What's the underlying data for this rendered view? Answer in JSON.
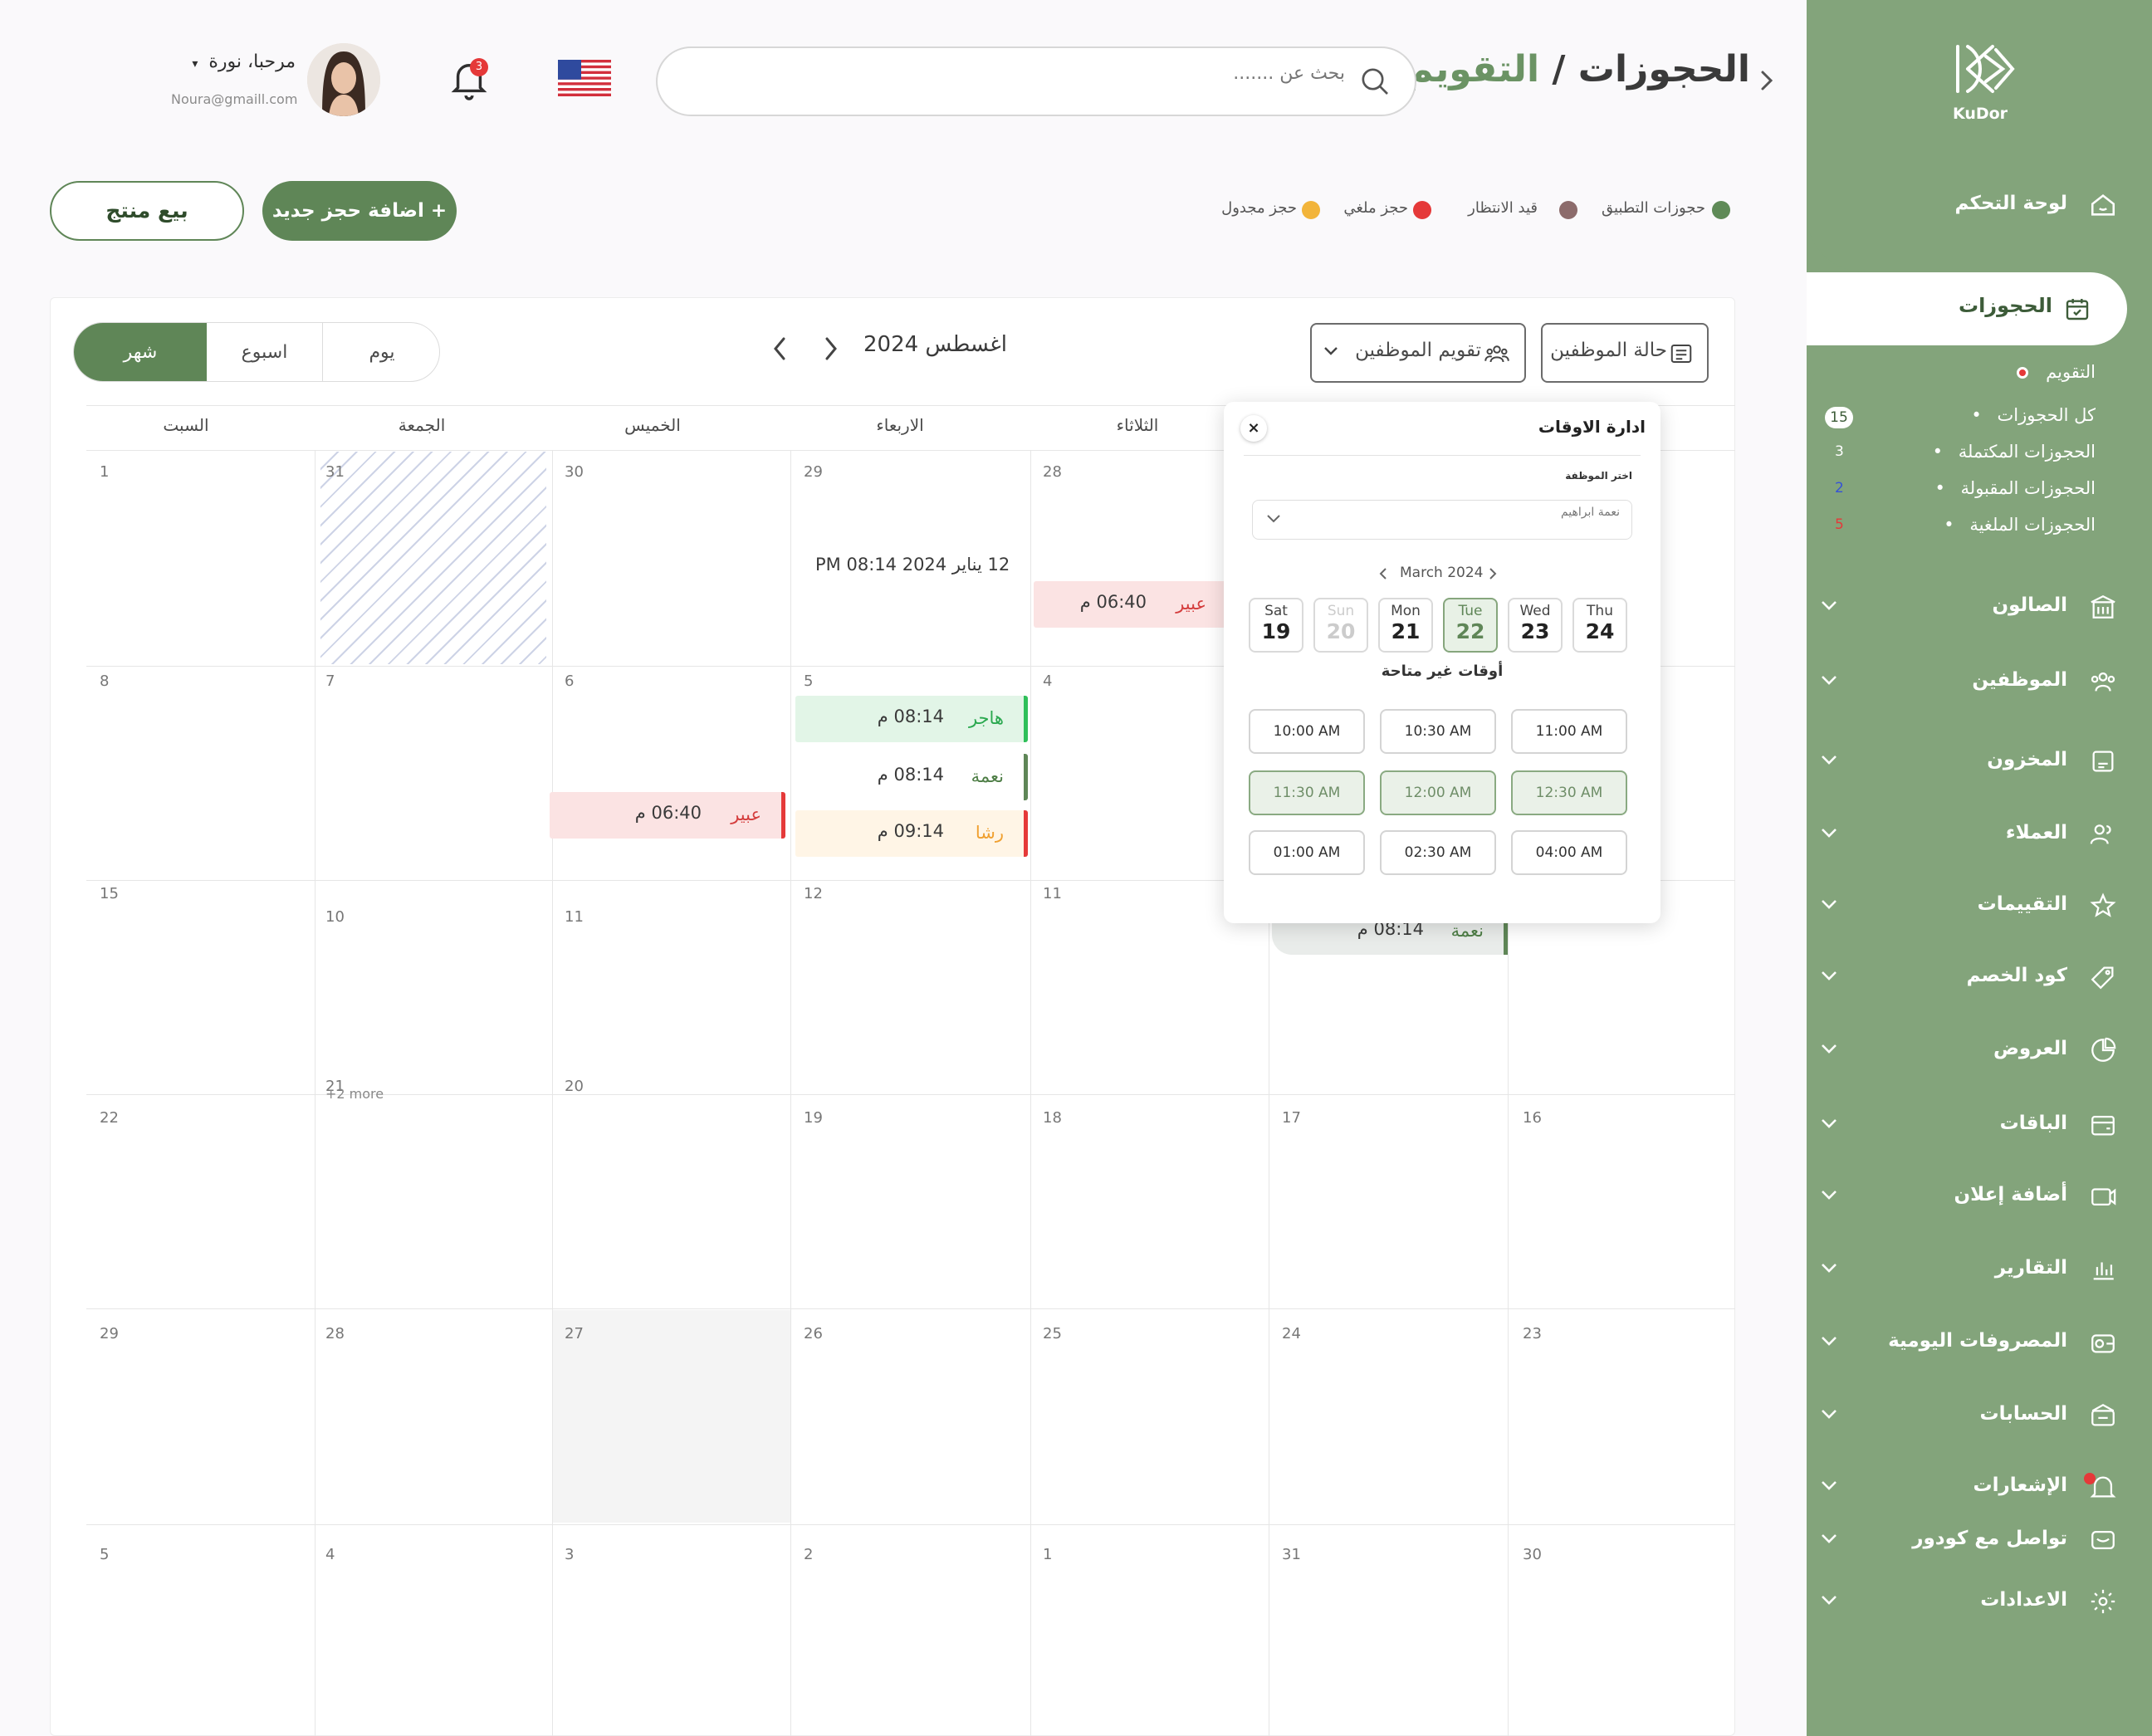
{
  "sidebar": {
    "logo_text": "KuDor",
    "dashboard": "لوحة التحكم",
    "bookings": "الحجوزات",
    "sub_items": [
      {
        "label": "التقويم",
        "count": ""
      },
      {
        "label": "كل الحجوزات",
        "count": "15"
      },
      {
        "label": "الحجوزات المكتملة",
        "count": "3"
      },
      {
        "label": "الحجوزات المقبولة",
        "count": "2"
      },
      {
        "label": "الحجوزات الملغية",
        "count": "5"
      }
    ],
    "items": [
      "الصالون",
      "الموظفين",
      "المخزون",
      "العملاء",
      "التقييمات",
      "كود الخصم",
      "العروض",
      "الباقات",
      "أضافة إعلان",
      "التقارير",
      "المصروفات اليومية",
      "الحسابات",
      "الإشعارات",
      "تواصل مع كودور",
      "الاعدادات"
    ]
  },
  "header": {
    "breadcrumb_parent": "الحجوزات /",
    "breadcrumb_current": "التقويم",
    "search_placeholder": "بحث عن .......",
    "notifications_count": "3",
    "greeting": "مرحبا، نورة",
    "email": "Noura@gmaill.com"
  },
  "actions": {
    "add_booking": "+ اضافة حجز جديد",
    "sell_product": "بيع منتج"
  },
  "legend": [
    {
      "label": "حجوزات التطبيق",
      "color": "#5f8a57"
    },
    {
      "label": "قيد الانتظار",
      "color": "#8c6b6b"
    },
    {
      "label": "حجز ملغي",
      "color": "#e53939"
    },
    {
      "label": "حجز مجدول",
      "color": "#f2b43a"
    }
  ],
  "calendar": {
    "views": {
      "day": "يوم",
      "week": "اسبوع",
      "month": "شهر"
    },
    "month_title": "اغسطس 2024",
    "staff_calendar": "تقويم الموظفين",
    "staff_status": "حالة الموظفين",
    "weekdays": [
      "السبت",
      "الجمعة",
      "الخميس",
      "الاربعاء",
      "الثلاثاء"
    ],
    "days": {
      "r1": [
        "1",
        "31",
        "30",
        "29",
        "28"
      ],
      "r2": [
        "8",
        "7",
        "6",
        "5",
        "4"
      ],
      "r3": [
        "15",
        "10",
        "11",
        "12",
        "11"
      ],
      "r4": [
        "22",
        "21",
        "20",
        "19",
        "18",
        "17",
        "16"
      ],
      "r5": [
        "29",
        "28",
        "27",
        "26",
        "25",
        "24",
        "23"
      ],
      "r6": [
        "5",
        "4",
        "3",
        "2",
        "1",
        "31",
        "30"
      ]
    },
    "more_link": "+2 more",
    "floating_date": "12 يناير 2024 08:14 PM",
    "events": [
      {
        "name": "عبير",
        "time": "06:40 م",
        "bg": "#fbe3e3",
        "name_color": "#d43d3d"
      },
      {
        "name": "هاجر",
        "time": "08:14 م",
        "bg": "#e2f5e7",
        "name_color": "#2aa84f"
      },
      {
        "name": "نعمة",
        "time": "08:14 م",
        "bg": "#ffffff",
        "name_color": "#4d7d45"
      },
      {
        "name": "عبير",
        "time": "06:40 م",
        "bg": "#fbe3e3",
        "name_color": "#d43d3d"
      },
      {
        "name": "رشا",
        "time": "09:14 م",
        "bg": "#fff5e6",
        "name_color": "#f0a030"
      },
      {
        "name": "نعمة",
        "time": "08:14 م",
        "bg": "#e9ecea",
        "name_color": "#4d7d45"
      }
    ]
  },
  "popup": {
    "title": "ادارة الاوقات",
    "employee_label": "اختر الموظفة",
    "employee_value": "نعمة ابراهيم",
    "month": "March 2024",
    "days": [
      {
        "wd": "Sat",
        "dn": "19"
      },
      {
        "wd": "Sun",
        "dn": "20"
      },
      {
        "wd": "Mon",
        "dn": "21"
      },
      {
        "wd": "Tue",
        "dn": "22"
      },
      {
        "wd": "Wed",
        "dn": "23"
      },
      {
        "wd": "Thu",
        "dn": "24"
      }
    ],
    "unavailable_title": "أوقات غير متاحة",
    "slots": [
      "10:00 AM",
      "10:30 AM",
      "11:00 AM",
      "11:30 AM",
      "12:00 AM",
      "12:30 AM",
      "01:00 AM",
      "02:30 AM",
      "04:00 AM"
    ]
  }
}
